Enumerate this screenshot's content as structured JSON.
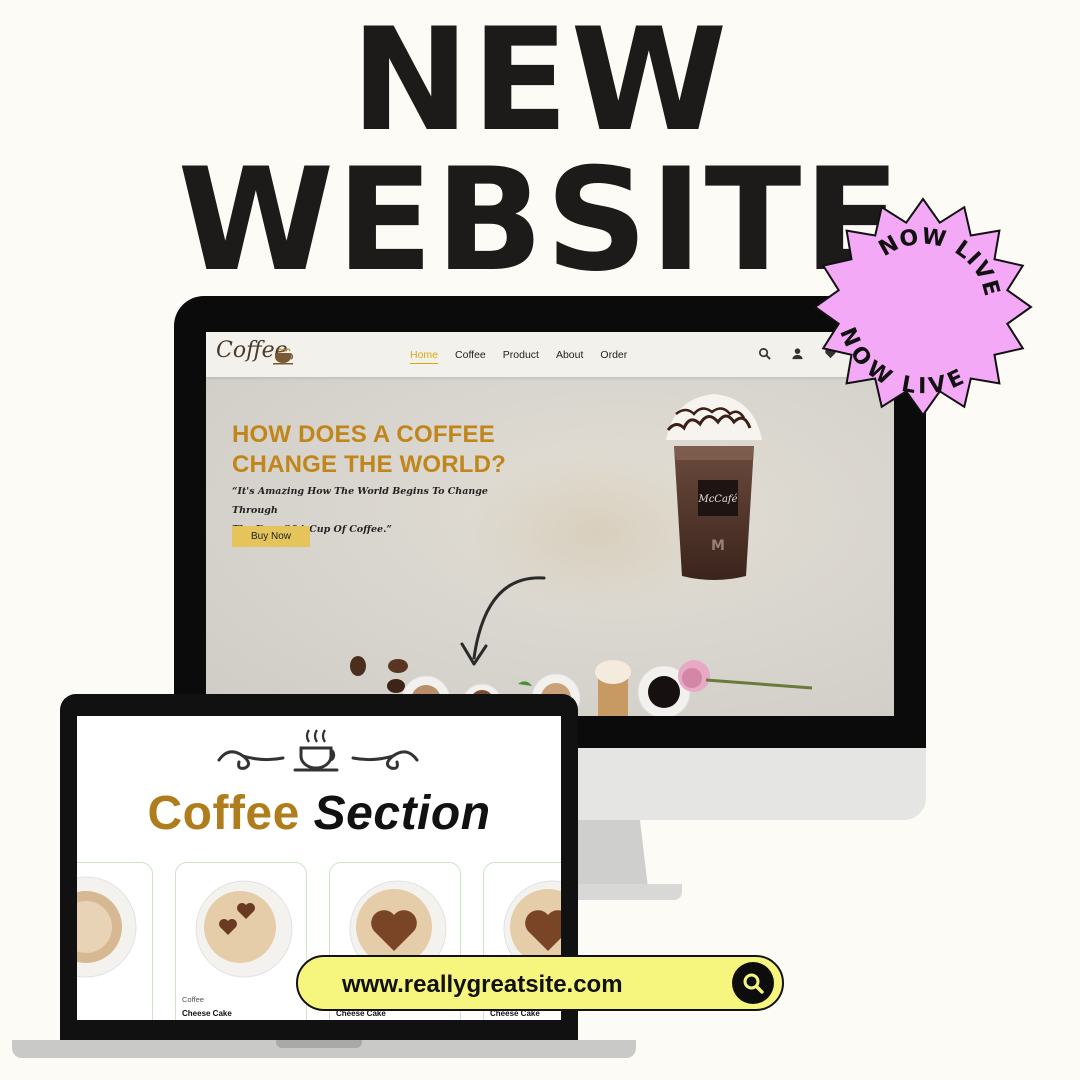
{
  "headline": {
    "line1": "NEW",
    "line2": "WEBSITE"
  },
  "badge": {
    "top_text": "NOW LIVE",
    "bottom_text": "NOW LIVE",
    "color": "#f4a9f7"
  },
  "site": {
    "logo": "Coffee",
    "nav": [
      "Home",
      "Coffee",
      "Product",
      "About",
      "Order"
    ],
    "nav_icons": [
      "search-icon",
      "user-icon",
      "heart-icon"
    ],
    "hero_title_line1": "HOW DOES A COFFEE",
    "hero_title_line2": "CHANGE THE WORLD?",
    "hero_quote_line1": "“It's Amazing How The World Begins To Change Through",
    "hero_quote_line2": "The Eyes Of A Cup Of Coffee.”",
    "buy_button": "Buy Now",
    "cup_brand": "McCafé"
  },
  "laptop": {
    "section_word1": "Coffee",
    "section_word2": "Section",
    "cards": [
      {
        "category": "",
        "name": ""
      },
      {
        "category": "Coffee",
        "name": "Cheese Cake"
      },
      {
        "category": "",
        "name": "Cheese Cake"
      },
      {
        "category": "",
        "name": "Cheese Cake"
      }
    ]
  },
  "url": {
    "text": "www.reallygreatsite.com"
  },
  "colors": {
    "background": "#fcfbf6",
    "accent_gold": "#c1861b",
    "url_pill": "#f6f67f",
    "button": "#e4c45b"
  }
}
